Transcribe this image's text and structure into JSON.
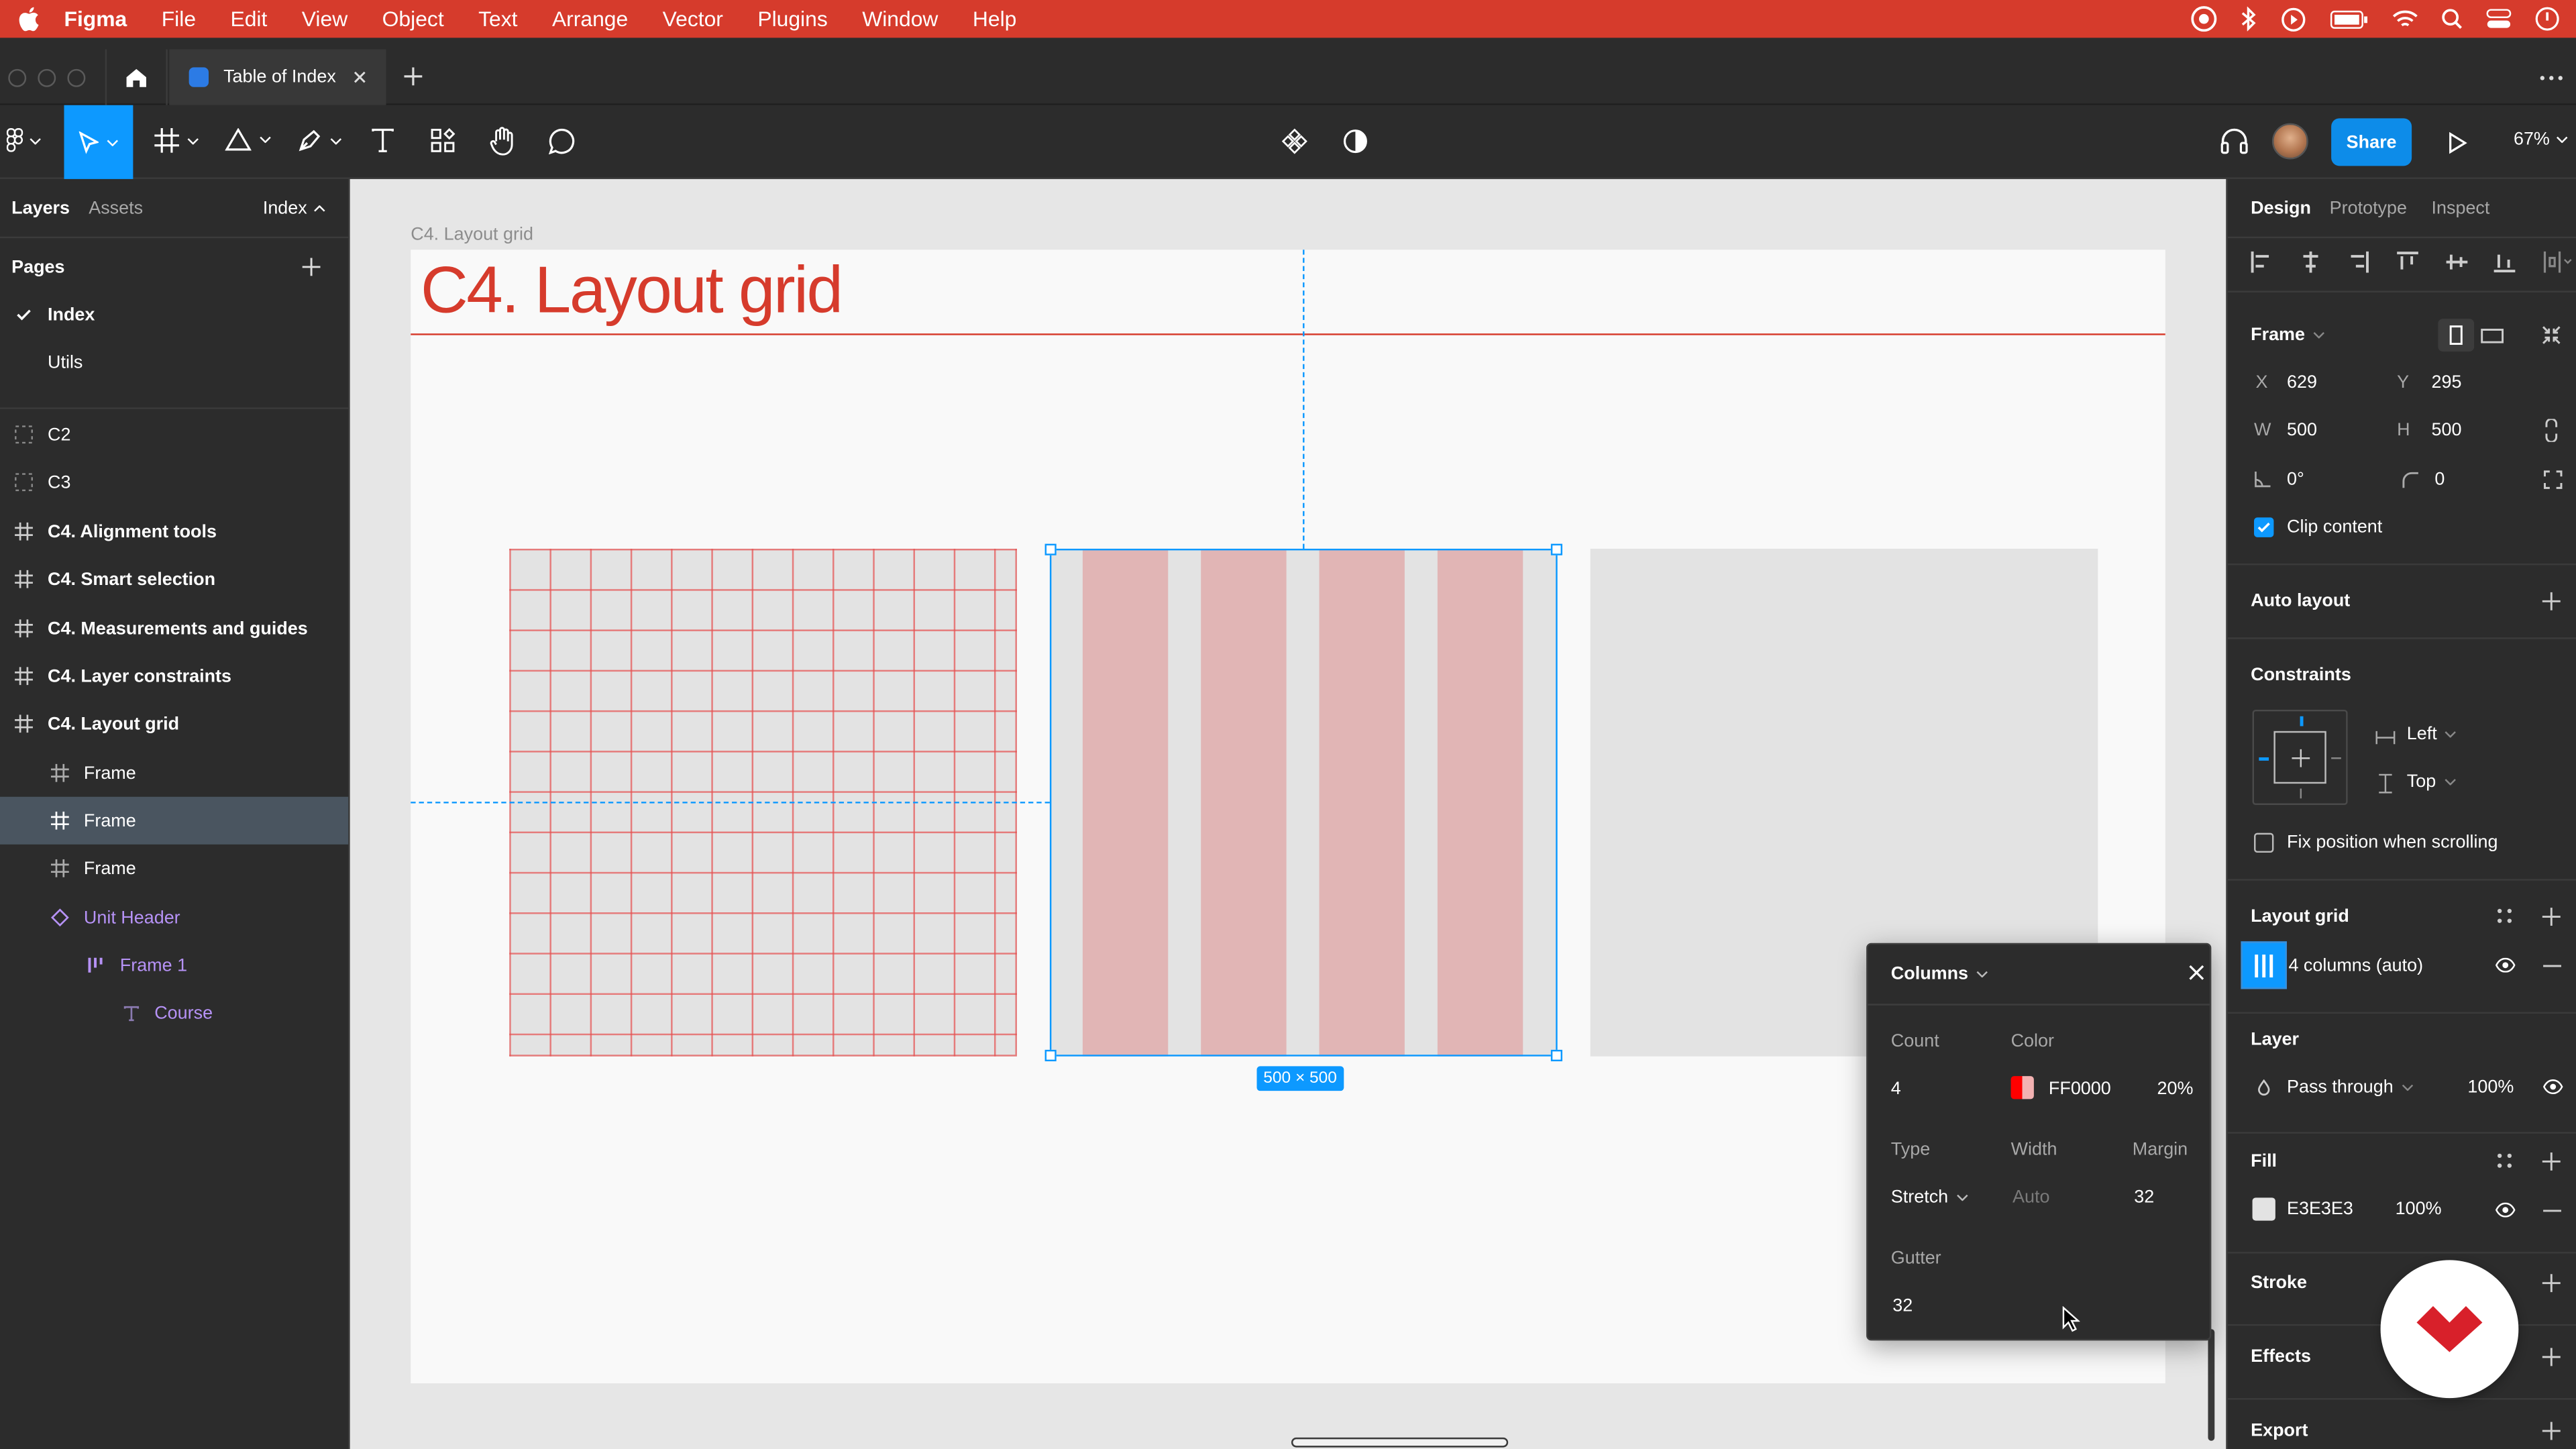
{
  "menubar": {
    "app": "Figma",
    "items": [
      "File",
      "Edit",
      "View",
      "Object",
      "Text",
      "Arrange",
      "Vector",
      "Plugins",
      "Window",
      "Help"
    ]
  },
  "tabs": {
    "file_title": "Table of Index"
  },
  "toolbar": {
    "share_label": "Share",
    "zoom": "67%"
  },
  "left": {
    "tab_layers": "Layers",
    "tab_assets": "Assets",
    "page_switch": "Index",
    "pages_title": "Pages",
    "pages": [
      "Index",
      "Utils"
    ],
    "layers": [
      "C2",
      "C3",
      "C4. Alignment tools",
      "C4. Smart selection",
      "C4. Measurements and guides",
      "C4. Layer constraints",
      "C4. Layout grid",
      "Frame",
      "Frame",
      "Frame",
      "Unit Header",
      "Frame 1",
      "Course"
    ]
  },
  "canvas": {
    "frame_label": "C4. Layout grid",
    "heading": "C4.  Layout grid",
    "size_badge": "500 × 500"
  },
  "popup": {
    "title": "Columns",
    "count_label": "Count",
    "count": "4",
    "color_label": "Color",
    "color_hex": "FF0000",
    "opacity": "20%",
    "type_label": "Type",
    "type_value": "Stretch",
    "width_label": "Width",
    "width_placeholder": "Auto",
    "margin_label": "Margin",
    "margin": "32",
    "gutter_label": "Gutter",
    "gutter": "32"
  },
  "right": {
    "tab_design": "Design",
    "tab_prototype": "Prototype",
    "tab_inspect": "Inspect",
    "frame_title": "Frame",
    "x_label": "X",
    "x": "629",
    "y_label": "Y",
    "y": "295",
    "w_label": "W",
    "w": "500",
    "h_label": "H",
    "h": "500",
    "rotation": "0°",
    "radius": "0",
    "clip_content": "Clip content",
    "auto_layout": "Auto layout",
    "constraints": "Constraints",
    "constraint_h": "Left",
    "constraint_v": "Top",
    "fix_position": "Fix position when scrolling",
    "layout_grid": "Layout grid",
    "grid_item": "4 columns (auto)",
    "layer": "Layer",
    "blend": "Pass through",
    "layer_opacity": "100%",
    "fill": "Fill",
    "fill_hex": "E3E3E3",
    "fill_opacity": "100%",
    "stroke": "Stroke",
    "effects": "Effects",
    "export": "Export"
  },
  "colors": {
    "menubar": "#d63b2c",
    "accent": "#0d99ff",
    "grid": "#ff0000",
    "fill": "#e3e3e3",
    "share": "#0d8ce9",
    "heading": "#d63b2c"
  }
}
